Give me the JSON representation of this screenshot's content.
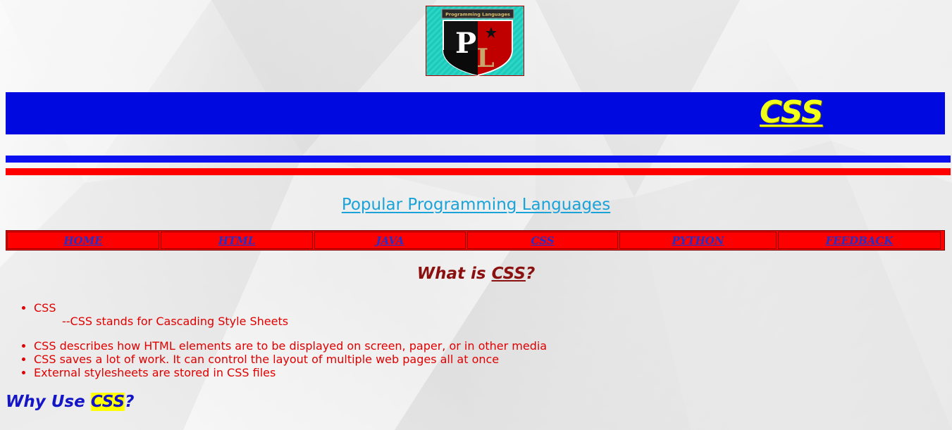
{
  "logo": {
    "caption": "Programming Languages",
    "letter1": "P",
    "letter2": "L",
    "icon": "shield-logo-icon"
  },
  "banner": {
    "title": "CSS"
  },
  "subtitle": "Popular Programming Languages",
  "nav": {
    "items": [
      {
        "label": "HOME"
      },
      {
        "label": "HTML"
      },
      {
        "label": "JAVA"
      },
      {
        "label": "CSS"
      },
      {
        "label": "PYTHON"
      },
      {
        "label": "FEEDBACK"
      }
    ]
  },
  "section1": {
    "heading_prefix": "What is ",
    "heading_term": "CSS",
    "heading_suffix": "?",
    "item1_title": "CSS",
    "item1_detail": "--CSS stands for Cascading Style Sheets",
    "item2": "CSS describes how HTML elements are to be displayed on screen, paper, or in other media",
    "item3": "CSS saves a lot of work. It can control the layout of multiple web pages all at once",
    "item4": "External stylesheets are stored in CSS files"
  },
  "section2": {
    "heading_prefix": "Why Use ",
    "heading_term": "CSS",
    "heading_suffix": "?"
  },
  "colors": {
    "banner_bg": "#0009e0",
    "banner_text": "#f2ff1a",
    "nav_bg": "#ff0000",
    "nav_text": "#2430c8",
    "list_text": "#e00000",
    "subtitle": "#1aa3d9",
    "heading_dark_red": "#8b1010",
    "why_blue": "#1515c8"
  }
}
